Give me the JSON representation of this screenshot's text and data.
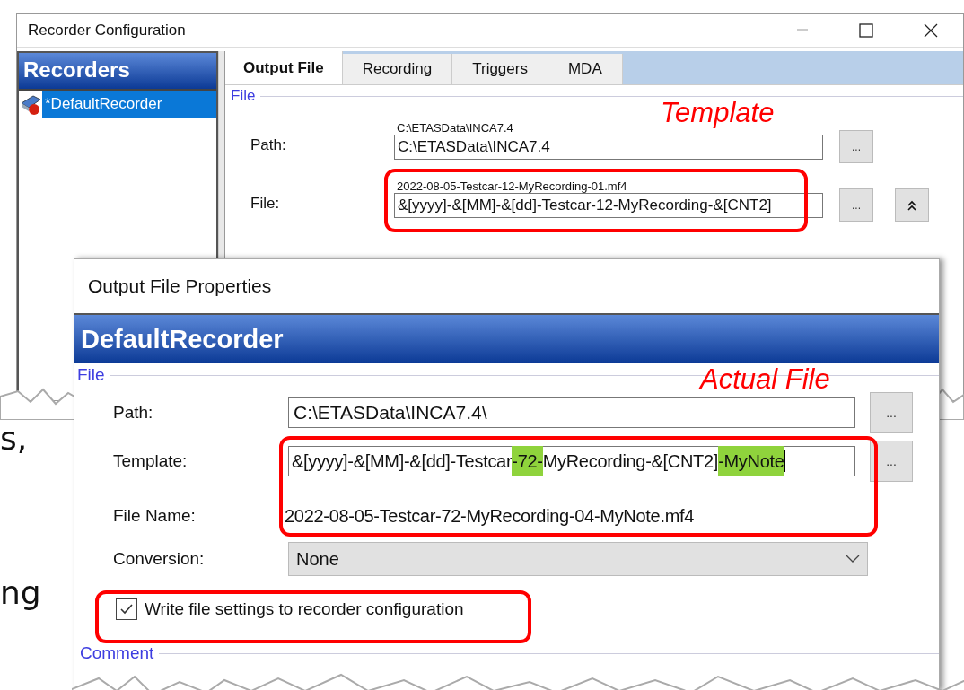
{
  "recorder_window": {
    "title": "Recorder Configuration",
    "sidebar": {
      "title": "Recorders",
      "items": [
        {
          "label": "*DefaultRecorder",
          "selected": true
        }
      ]
    },
    "tabs": [
      {
        "label": "Output File",
        "selected": true
      },
      {
        "label": "Recording",
        "selected": false
      },
      {
        "label": "Triggers",
        "selected": false
      },
      {
        "label": "MDA",
        "selected": false
      }
    ],
    "group": "File",
    "fields": [
      {
        "kind": "path",
        "label": "Path:",
        "caption": "C:\\ETASData\\INCA7.4",
        "value": "C:\\ETASData\\INCA7.4",
        "button": "..."
      },
      {
        "kind": "file",
        "label": "File:",
        "caption": "2022-08-05-Testcar-12-MyRecording-01.mf4",
        "value": "&[yyyy]-&[MM]-&[dd]-Testcar-12-MyRecording-&[CNT2]",
        "button": "..."
      }
    ]
  },
  "dialog": {
    "title": "Output File Properties",
    "header": "DefaultRecorder",
    "group": "File",
    "path": {
      "label": "Path:",
      "value": "C:\\ETASData\\INCA7.4\\",
      "button": "..."
    },
    "template": {
      "label": "Template:",
      "button": "...",
      "segments": [
        {
          "text": "&[yyyy]-&[MM]-&[dd]-Testcar",
          "highlighted": false
        },
        {
          "text": "-72-",
          "highlighted": true
        },
        {
          "text": "MyRecording-&[CNT2]",
          "highlighted": false
        },
        {
          "text": "-MyNote",
          "highlighted": true
        }
      ]
    },
    "file_name": {
      "label": "File Name:",
      "value": "2022-08-05-Testcar-72-MyRecording-04-MyNote.mf4"
    },
    "conversion": {
      "label": "Conversion:",
      "value": "None"
    },
    "write_settings": {
      "label": "Write file settings to recorder configuration",
      "checked": true
    },
    "second_group": "Comment"
  },
  "annotations": [
    {
      "text": "Template"
    },
    {
      "text": "Actual File"
    }
  ],
  "slide_text": [
    "s,",
    "ng"
  ]
}
